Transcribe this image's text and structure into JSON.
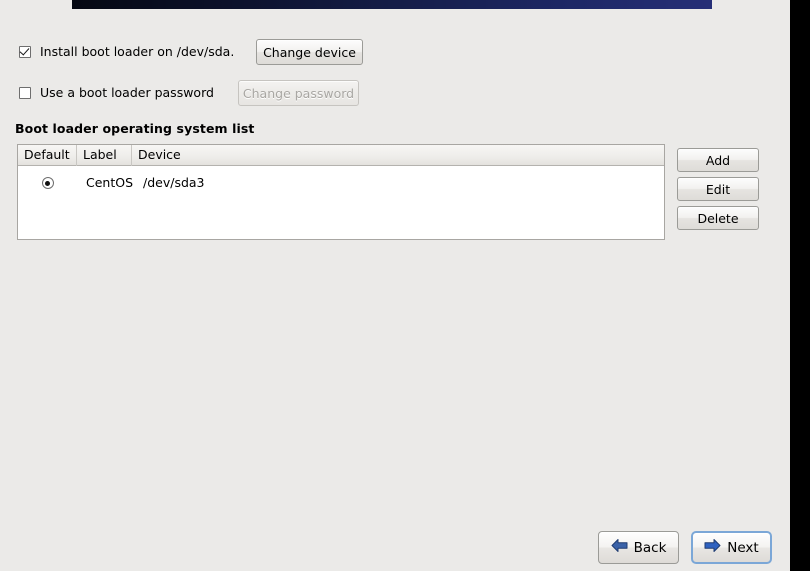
{
  "window": {
    "background_color": "#ebeae8",
    "banner": {
      "name": "title-gradient-bar",
      "gradient_from": "#050812",
      "gradient_to": "#262f77"
    },
    "right_strip_color": "#000000"
  },
  "options": {
    "install_bootloader": {
      "label": "Install boot loader on /dev/sda.",
      "checked": true,
      "action_button": "Change device",
      "action_enabled": true
    },
    "bootloader_password": {
      "label": "Use a boot loader password",
      "checked": false,
      "action_button": "Change password",
      "action_enabled": false
    }
  },
  "os_list": {
    "heading": "Boot loader operating system list",
    "columns": [
      "Default",
      "Label",
      "Device"
    ],
    "rows": [
      {
        "default": true,
        "label": "CentOS",
        "device": "/dev/sda3"
      }
    ],
    "buttons": [
      {
        "label": "Add",
        "name": "add-button"
      },
      {
        "label": "Edit",
        "name": "edit-button"
      },
      {
        "label": "Delete",
        "name": "delete-button"
      }
    ]
  },
  "navigation": {
    "back": {
      "label": "Back",
      "icon": "arrow-left-icon",
      "icon_color": "#3a62a8",
      "focused": false
    },
    "next": {
      "label": "Next",
      "icon": "arrow-right-icon",
      "icon_color": "#2f62c0",
      "focused": true
    }
  }
}
